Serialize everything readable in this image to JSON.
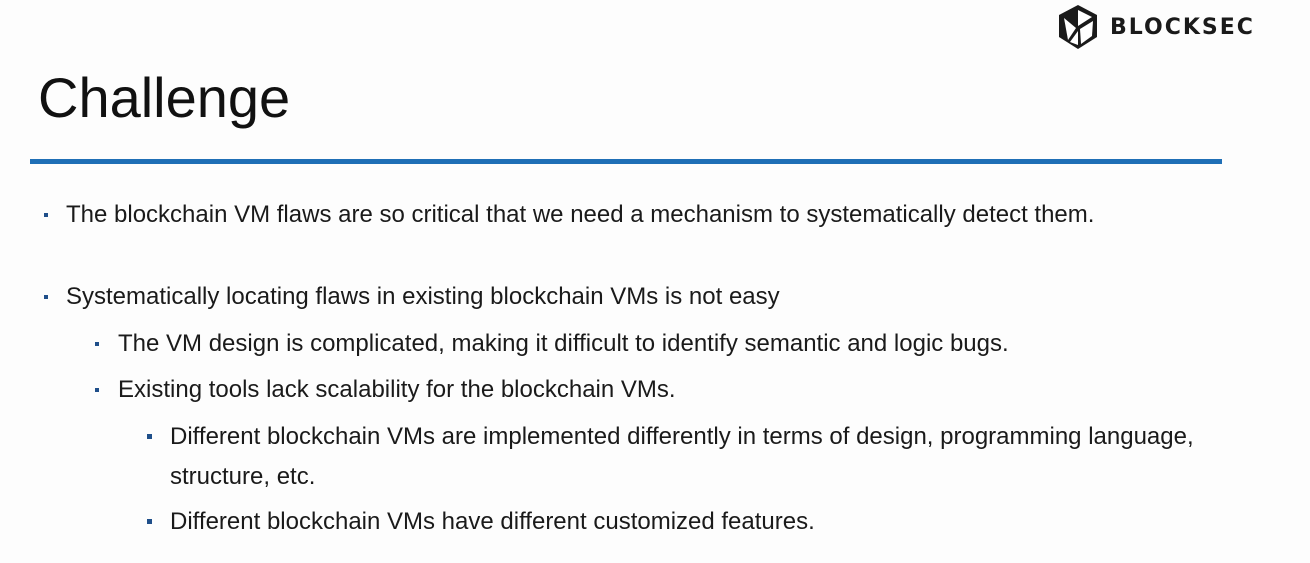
{
  "brand": {
    "name": "BLOCKSEC",
    "logo_icon": "blocksec-polyhedron-logo"
  },
  "slide": {
    "title": "Challenge",
    "accent_color": "#1f6fb6",
    "bullets": [
      {
        "level": 1,
        "text": "The blockchain VM flaws are so critical that we need a mechanism to systematically detect them."
      },
      {
        "level": 1,
        "text": "Systematically locating flaws in existing blockchain VMs is not easy"
      },
      {
        "level": 2,
        "text": "The VM design is complicated, making it difficult to identify semantic and logic bugs."
      },
      {
        "level": 2,
        "text": "Existing tools lack scalability for the blockchain VMs."
      },
      {
        "level": 3,
        "text": "Different blockchain VMs are implemented differently in terms of design, programming language, structure, etc."
      },
      {
        "level": 3,
        "text": "Different blockchain VMs have different customized features."
      }
    ]
  }
}
